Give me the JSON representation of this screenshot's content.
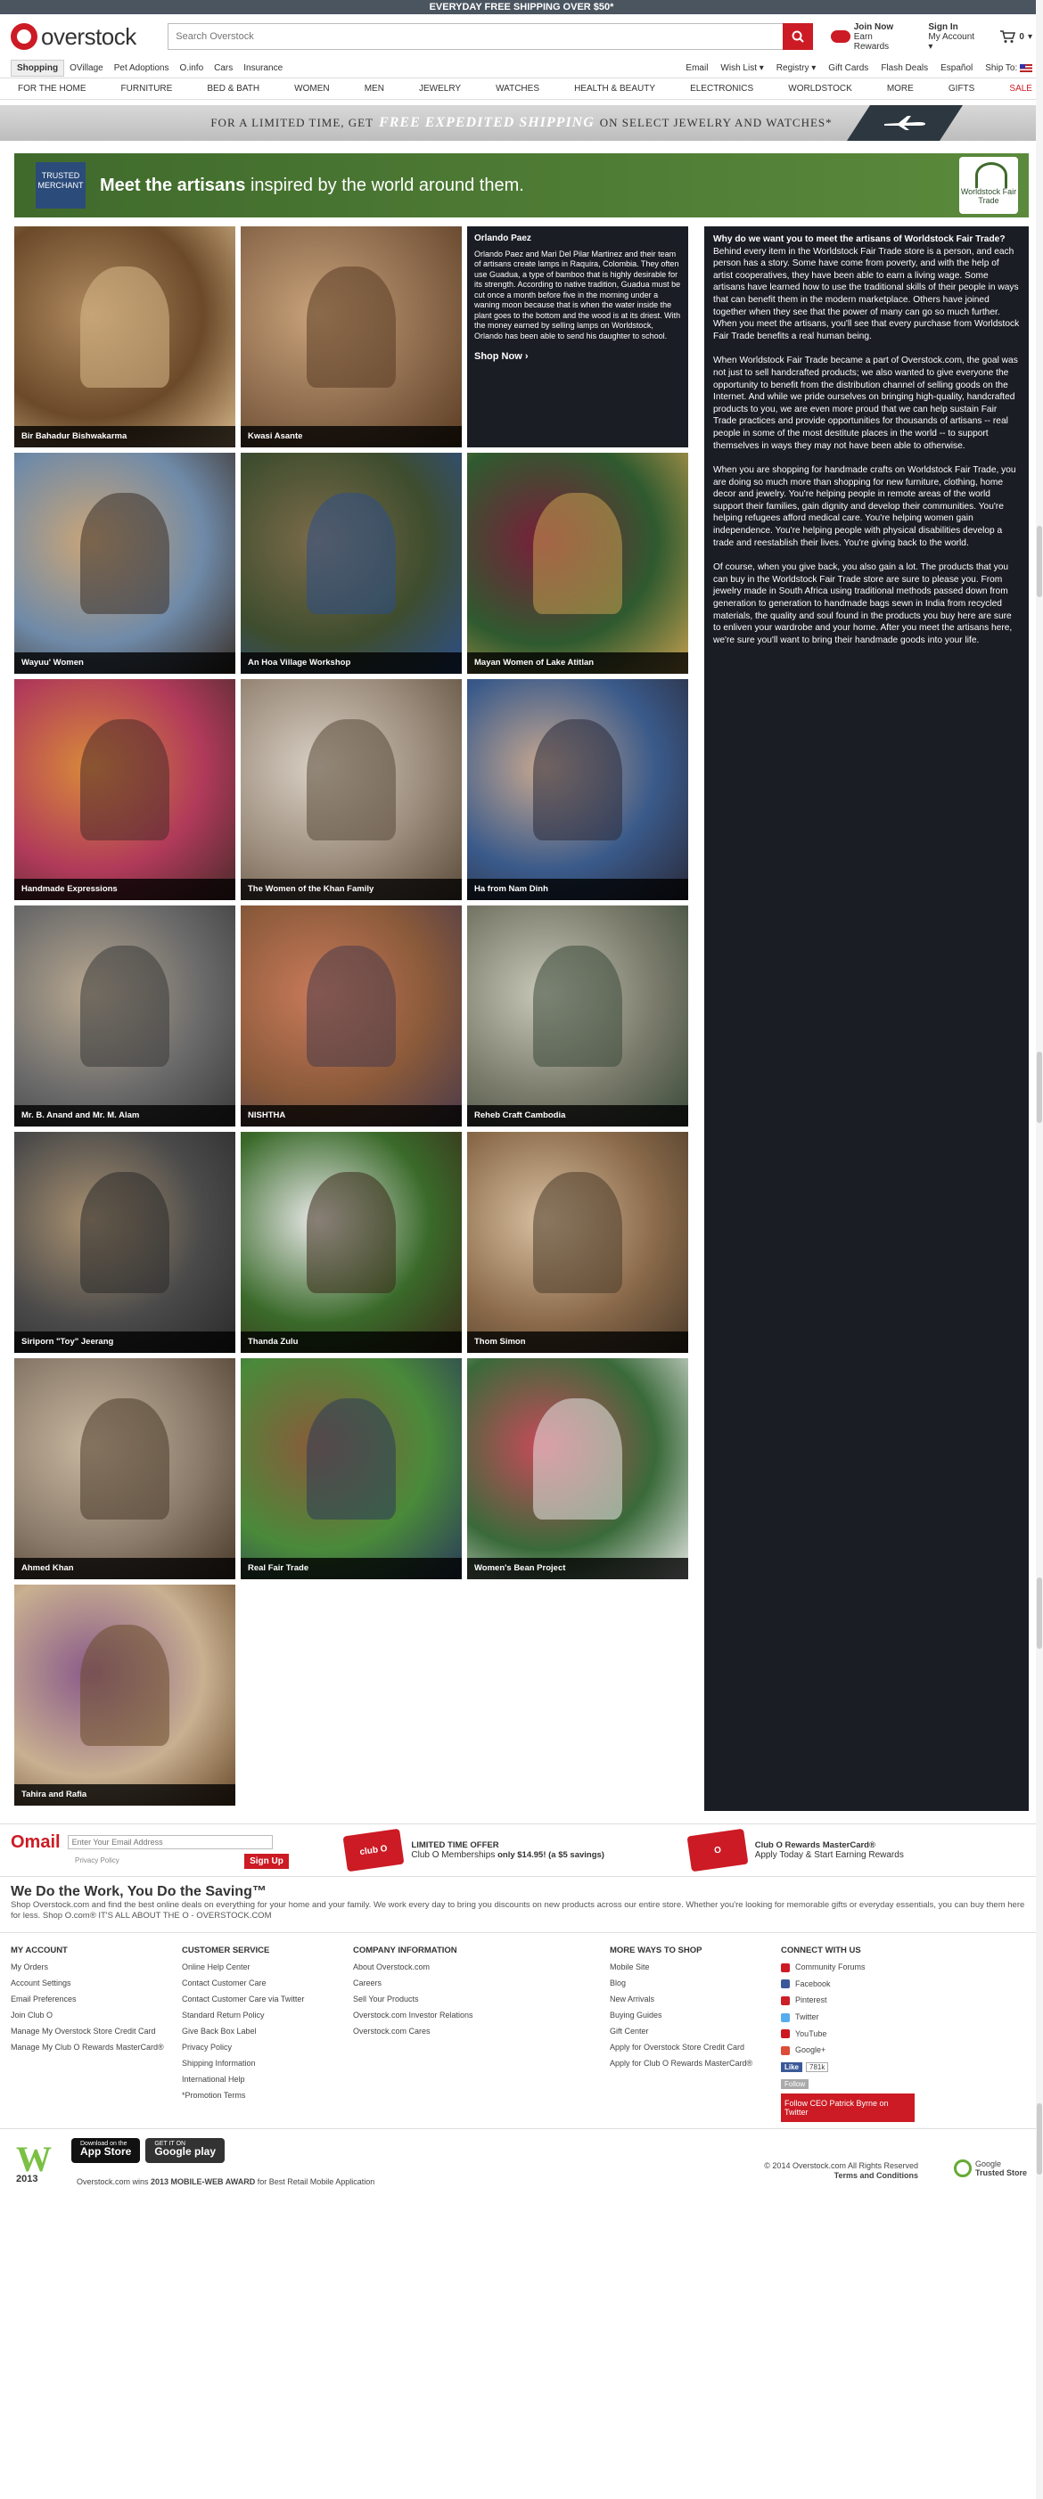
{
  "topbar": {
    "text": "EVERYDAY FREE SHIPPING OVER $50*"
  },
  "header": {
    "logo": "overstock",
    "search_placeholder": "Search Overstock",
    "clubo_join": "Join Now",
    "clubo_rewards": "Earn Rewards",
    "signin": "Sign In",
    "my_account": "My Account",
    "cart_count": "0"
  },
  "nav1": {
    "tabs": [
      "Shopping",
      "OVillage",
      "Pet Adoptions",
      "O.info",
      "Cars",
      "Insurance"
    ],
    "right": [
      "Email",
      "Wish List",
      "Registry",
      "Gift Cards",
      "Flash Deals",
      "Español",
      "Ship To:"
    ]
  },
  "nav2": [
    "FOR THE HOME",
    "FURNITURE",
    "BED & BATH",
    "WOMEN",
    "MEN",
    "JEWELRY",
    "WATCHES",
    "HEALTH & BEAUTY",
    "ELECTRONICS",
    "WORLDSTOCK",
    "MORE",
    "GIFTS",
    "SALE"
  ],
  "promo": {
    "pre": "FOR A LIMITED TIME, GET",
    "em": "FREE EXPEDITED SHIPPING",
    "post": "ON SELECT JEWELRY AND WATCHES*"
  },
  "banner": {
    "badge": "TRUSTED MERCHANT",
    "title_bold": "Meet the artisans",
    "title_rest": " inspired by the world around them.",
    "logo": "Worldstock Fair Trade"
  },
  "featured": {
    "title": "Orlando Paez",
    "text": "Orlando Paez and Mari Del Pilar Martinez and their team of artisans create lamps in Raquira, Colombia. They often use Guadua, a type of bamboo that is highly desirable for its strength. According to native tradition, Guadua must be cut once a month before five in the morning under a waning moon because that is when the water inside the plant goes to the bottom and the wood is at its driest. With the money earned by selling lamps on Worldstock, Orlando has been able to send his daughter to school.",
    "cta": "Shop Now ›"
  },
  "artisans": [
    {
      "name": "Bir Bahadur Bishwakarma",
      "colors": [
        "#6b4a2a",
        "#b08a5f",
        "#d9b98b"
      ]
    },
    {
      "name": "Kwasi Asante",
      "colors": [
        "#8c6a4c",
        "#c8a27a",
        "#5a3c24"
      ]
    },
    {
      "name": "Wayuu' Women",
      "colors": [
        "#6f8aa8",
        "#caa578",
        "#3a2f28"
      ]
    },
    {
      "name": "An Hoa Village Workshop",
      "colors": [
        "#3e4d2e",
        "#7b6b4a",
        "#2d4e8a"
      ]
    },
    {
      "name": "Mayan Women of Lake Atitlan",
      "colors": [
        "#2f5a2f",
        "#7a1e3a",
        "#c8a050"
      ]
    },
    {
      "name": "Handmade Expressions",
      "colors": [
        "#b03a5a",
        "#d88a3a",
        "#4a2a2a"
      ]
    },
    {
      "name": "The Women of the Khan Family",
      "colors": [
        "#9a8a7a",
        "#d8d0c4",
        "#5a4a3a"
      ]
    },
    {
      "name": "Ha from Nam Dinh",
      "colors": [
        "#3a5a8a",
        "#c8a890",
        "#2a2a3a"
      ]
    },
    {
      "name": "Mr. B. Anand and Mr. M. Alam",
      "colors": [
        "#6a6a6a",
        "#b8a890",
        "#3a3a3a"
      ]
    },
    {
      "name": "NISHTHA",
      "colors": [
        "#8a5a3a",
        "#c87a5a",
        "#4a3a4a"
      ]
    },
    {
      "name": "Reheb Craft Cambodia",
      "colors": [
        "#7a7a6a",
        "#c8c8b8",
        "#3a4a3a"
      ]
    },
    {
      "name": "Siriporn \"Toy\" Jeerang",
      "colors": [
        "#4a4a4a",
        "#a89070",
        "#2a2a2a"
      ]
    },
    {
      "name": "Thanda Zulu",
      "colors": [
        "#3a6a2a",
        "#e8e8e8",
        "#3a2a1a"
      ]
    },
    {
      "name": "Thom Simon",
      "colors": [
        "#8a6a4a",
        "#d8c0a0",
        "#4a3a2a"
      ]
    },
    {
      "name": "Ahmed Khan",
      "colors": [
        "#8a7a6a",
        "#c8b8a0",
        "#4a3a2a"
      ]
    },
    {
      "name": "Real Fair Trade",
      "colors": [
        "#4a8a3a",
        "#8a5a3a",
        "#2a3a5a"
      ]
    },
    {
      "name": "Women's Bean Project",
      "colors": [
        "#3a6a3a",
        "#c84a5a",
        "#e8e8e8"
      ]
    },
    {
      "name": "Tahira and Rafia",
      "colors": [
        "#c8b090",
        "#8a5a8a",
        "#6a4a2a"
      ]
    }
  ],
  "sidebar": {
    "p1_bold": "Why do we want you to meet the artisans of Worldstock Fair Trade?",
    "p1": " Behind every item in the Worldstock Fair Trade store is a person, and each person has a story. Some have come from poverty, and with the help of artist cooperatives, they have been able to earn a living wage. Some artisans have learned how to use the traditional skills of their people in ways that can benefit them in the modern marketplace. Others have joined together when they see that the power of many can go so much further. When you meet the artisans, you'll see that every purchase from Worldstock Fair Trade benefits a real human being.",
    "p2": "When Worldstock Fair Trade became a part of Overstock.com, the goal was not just to sell handcrafted products; we also wanted to give everyone the opportunity to benefit from the distribution channel of selling goods on the Internet. And while we pride ourselves on bringing high-quality, handcrafted products to you, we are even more proud that we can help sustain Fair Trade practices and provide opportunities for thousands of artisans -- real people in some of the most destitute places in the world -- to support themselves in ways they may not have been able to otherwise.",
    "p3": "When you are shopping for handmade crafts on Worldstock Fair Trade, you are doing so much more than shopping for new furniture, clothing, home decor and jewelry. You're helping people in remote areas of the world support their families, gain dignity and develop their communities. You're helping refugees afford medical care. You're helping women gain independence. You're helping people with physical disabilities develop a trade and reestablish their lives. You're giving back to the world.",
    "p4": "Of course, when you give back, you also gain a lot. The products that you can buy in the Worldstock Fair Trade store are sure to please you. From jewelry made in South Africa using traditional methods passed down from generation to generation to handmade bags sewn in India from recycled materials, the quality and soul found in the products you buy here are sure to enliven your wardrobe and your home. After you meet the artisans here, we're sure you'll want to bring their handmade goods into your life."
  },
  "omail": {
    "logo": "Omail",
    "placeholder": "Enter Your Email Address",
    "privacy": "Privacy Policy",
    "signup": "Sign Up"
  },
  "offer1": {
    "card": "club O",
    "title": "LIMITED TIME OFFER",
    "text_pre": "Club O Memberships ",
    "text_bold": "only $14.95! (a $5 savings)"
  },
  "offer2": {
    "card": "O",
    "title": "Club O Rewards MasterCard®",
    "text": "Apply Today & Start Earning Rewards"
  },
  "tagline": {
    "title": "We Do the Work, You Do the Saving™",
    "text": "Shop Overstock.com and find the best online deals on everything for your home and your family. We work every day to bring you discounts on new products across our entire store. Whether you're looking for memorable gifts or everyday essentials, you can buy them here for less.      Shop O.com®      IT'S ALL ABOUT THE O - OVERSTOCK.COM"
  },
  "footer": [
    {
      "title": "MY ACCOUNT",
      "items": [
        "My Orders",
        "Account Settings",
        "Email Preferences",
        "Join Club O",
        "Manage My Overstock Store Credit Card",
        "Manage My Club O Rewards MasterCard®"
      ]
    },
    {
      "title": "CUSTOMER SERVICE",
      "items": [
        "Online Help Center",
        "Contact Customer Care",
        "Contact Customer Care via Twitter",
        "Standard Return Policy",
        "Give Back Box Label",
        "Privacy Policy",
        "Shipping Information",
        "International Help",
        "*Promotion Terms"
      ]
    },
    {
      "title": "COMPANY INFORMATION",
      "items": [
        "About Overstock.com",
        "Careers",
        "Sell Your Products",
        "Overstock.com Investor Relations",
        "Overstock.com Cares"
      ]
    },
    {
      "title": "MORE WAYS TO SHOP",
      "items": [
        "Mobile Site",
        "Blog",
        "New Arrivals",
        "Buying Guides",
        "Gift Center",
        "Apply for Overstock Store Credit Card",
        "Apply for Club O Rewards MasterCard®"
      ]
    }
  ],
  "connect": {
    "title": "CONNECT WITH US",
    "items": [
      {
        "label": "Community Forums",
        "color": "#cc1b24"
      },
      {
        "label": "Facebook",
        "color": "#3b5998"
      },
      {
        "label": "Pinterest",
        "color": "#cb2027"
      },
      {
        "label": "Twitter",
        "color": "#55acee"
      },
      {
        "label": "YouTube",
        "color": "#cc181e"
      },
      {
        "label": "Google+",
        "color": "#dd4b39"
      }
    ],
    "like": "Like",
    "like_count": "781k",
    "follow": "Follow",
    "ceo": "Follow CEO Patrick Byrne on Twitter"
  },
  "award": {
    "w": "W",
    "year": "2013",
    "text_pre": "Overstock.com wins ",
    "text_bold": "2013 MOBILE-WEB AWARD",
    "text_post": " for Best Retail Mobile Application"
  },
  "stores": [
    {
      "small": "Download on the",
      "big": "App Store"
    },
    {
      "small": "GET IT ON",
      "big": "Google play"
    }
  ],
  "copyright": {
    "line1": "© 2014 Overstock.com All Rights Reserved",
    "line2": "Terms and Conditions"
  },
  "gts": {
    "line1": "Google",
    "line2": "Trusted Store"
  }
}
